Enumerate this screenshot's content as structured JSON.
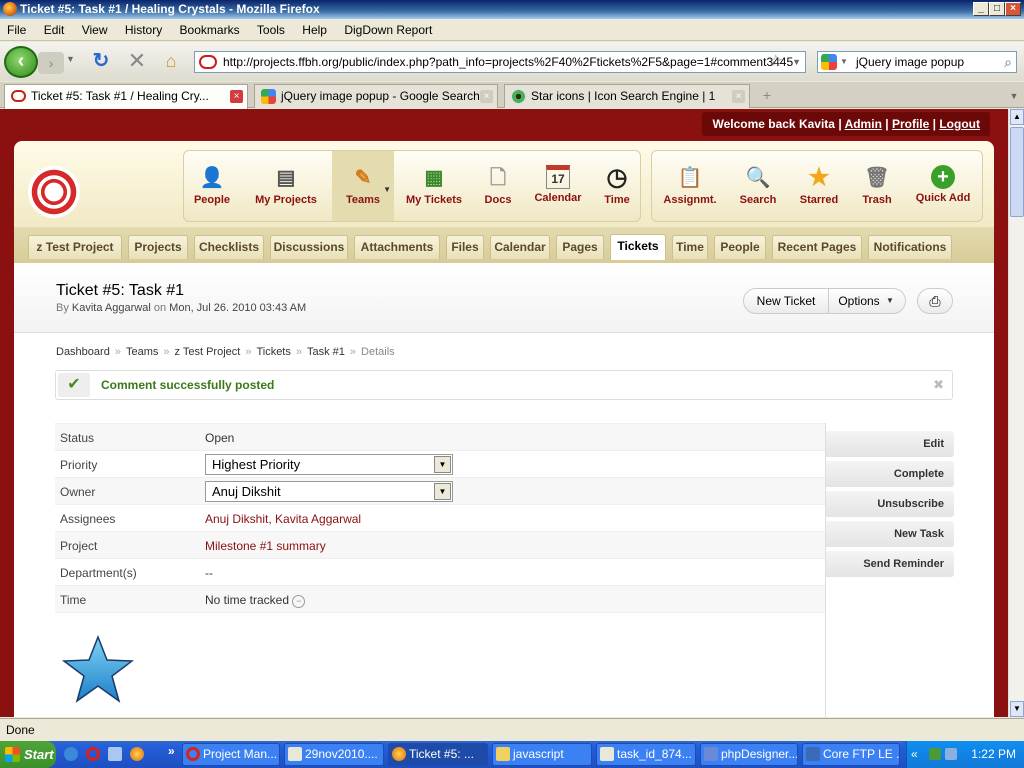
{
  "window": {
    "title": "Ticket #5: Task #1 / Healing Crystals - Mozilla Firefox"
  },
  "menu": [
    "File",
    "Edit",
    "View",
    "History",
    "Bookmarks",
    "Tools",
    "Help",
    "DigDown Report"
  ],
  "nav": {
    "url": "http://projects.ffbh.org/public/index.php?path_info=projects%2F40%2Ftickets%2F5&page=1#comment3445",
    "search_value": "jQuery image popup"
  },
  "browser_tabs": [
    {
      "label": "Ticket #5: Task #1 / Healing Cry...",
      "active": true,
      "icon": "site-icon"
    },
    {
      "label": "jQuery image popup - Google Search",
      "active": false,
      "icon": "google-icon"
    },
    {
      "label": "Star icons | Icon Search Engine | 1",
      "active": false,
      "icon": "eye-icon"
    }
  ],
  "welcome": {
    "text": "Welcome back Kavita",
    "admin": "Admin",
    "profile": "Profile",
    "logout": "Logout",
    "sep": "|"
  },
  "toolbar_main": [
    {
      "label": "People",
      "icon": "people-icon",
      "glyph": "👤"
    },
    {
      "label": "My Projects",
      "icon": "projects-icon",
      "glyph": "▤"
    },
    {
      "label": "Teams",
      "icon": "teams-icon",
      "glyph": "✎"
    },
    {
      "label": "My Tickets",
      "icon": "tickets-icon",
      "glyph": "▦"
    },
    {
      "label": "Docs",
      "icon": "docs-icon",
      "glyph": "🗋"
    },
    {
      "label": "Calendar",
      "icon": "calendar-icon",
      "glyph": "17"
    },
    {
      "label": "Time",
      "icon": "clock-icon",
      "glyph": "◷"
    }
  ],
  "toolbar_side": [
    {
      "label": "Assignmt.",
      "icon": "clipboard-icon",
      "glyph": "📋"
    },
    {
      "label": "Search",
      "icon": "search-icon",
      "glyph": "🔍"
    },
    {
      "label": "Starred",
      "icon": "star-icon",
      "glyph": "★"
    },
    {
      "label": "Trash",
      "icon": "trash-icon",
      "glyph": "🗑"
    },
    {
      "label": "Quick Add",
      "icon": "add-icon",
      "glyph": "+"
    }
  ],
  "subtabs": [
    "z Test Project",
    "Projects",
    "Checklists",
    "Discussions",
    "Attachments",
    "Files",
    "Calendar",
    "Pages",
    "Tickets",
    "Time",
    "People",
    "Recent Pages",
    "Notifications"
  ],
  "active_subtab": "Tickets",
  "ticket": {
    "title": "Ticket #5: Task #1",
    "by_prefix": "By",
    "author": "Kavita Aggarwal",
    "on": "on",
    "date": "Mon, Jul 26. 2010 03:43 AM",
    "new_ticket": "New Ticket",
    "options": "Options"
  },
  "breadcrumb": [
    "Dashboard",
    "Teams",
    "z Test Project",
    "Tickets",
    "Task #1",
    "Details"
  ],
  "flash": {
    "message": "Comment successfully posted"
  },
  "props": {
    "status_label": "Status",
    "status_value": "Open",
    "priority_label": "Priority",
    "priority_value": "Highest Priority",
    "owner_label": "Owner",
    "owner_value": "Anuj Dikshit",
    "assignees_label": "Assignees",
    "assignees_value": "Anuj Dikshit, Kavita Aggarwal",
    "project_label": "Project",
    "project_value": "Milestone #1 summary",
    "department_label": "Department(s)",
    "department_value": "--",
    "time_label": "Time",
    "time_value": "No time tracked"
  },
  "actions": [
    "Edit",
    "Complete",
    "Unsubscribe",
    "New Task",
    "Send Reminder"
  ],
  "statusbar": {
    "text": "Done"
  },
  "taskbar": {
    "start": "Start",
    "items": [
      "Project Man...",
      "29nov2010....",
      "Ticket #5: ...",
      "javascript",
      "task_id_874...",
      "phpDesigner...",
      "Core FTP LE ..."
    ],
    "clock": "1:22 PM"
  },
  "colors": {
    "brand": "#8b1010",
    "header_bg": "#ece3b8",
    "accent_green": "#3a7a1a"
  }
}
